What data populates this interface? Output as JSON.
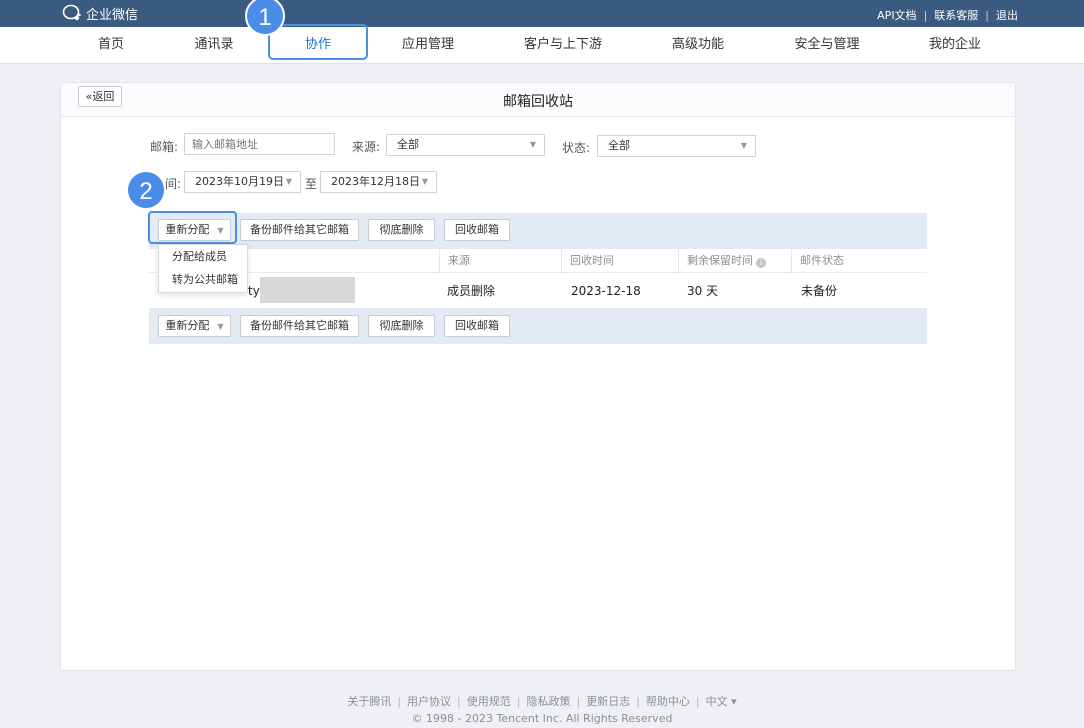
{
  "topbar": {
    "brand": "企业微信",
    "links": [
      "API文档",
      "联系客服",
      "退出"
    ]
  },
  "nav": {
    "items": [
      "首页",
      "通讯录",
      "协作",
      "应用管理",
      "客户与上下游",
      "高级功能",
      "安全与管理",
      "我的企业"
    ],
    "active": "协作"
  },
  "annotations": {
    "step1": "1",
    "step2": "2"
  },
  "page": {
    "back_label": "«返回",
    "title": "邮箱回收站"
  },
  "filters": {
    "email_label": "邮箱:",
    "email_placeholder": "输入邮箱地址",
    "source_label": "来源:",
    "source_value": "全部",
    "status_label": "状态:",
    "status_value": "全部",
    "time_label": "间:",
    "date_from": "2023年10月19日",
    "date_to_label": "至",
    "date_to": "2023年12月18日"
  },
  "actions": {
    "reassign": "重新分配",
    "backup": "备份邮件给其它邮箱",
    "delete": "彻底删除",
    "recycle": "回收邮箱"
  },
  "dropdown": {
    "items": [
      "分配给成员",
      "转为公共邮箱"
    ]
  },
  "table": {
    "headers": [
      "来源",
      "回收时间",
      "剩余保留时间",
      "邮件状态"
    ],
    "rows": [
      {
        "email_partial": "ty",
        "source": "成员删除",
        "time": "2023-12-18",
        "remaining": "30 天",
        "status": "未备份"
      }
    ]
  },
  "footer": {
    "links": [
      "关于腾讯",
      "用户协议",
      "使用规范",
      "隐私政策",
      "更新日志",
      "帮助中心",
      "中文 ▾"
    ],
    "copyright": "© 1998 - 2023 Tencent Inc. All Rights Reserved"
  }
}
